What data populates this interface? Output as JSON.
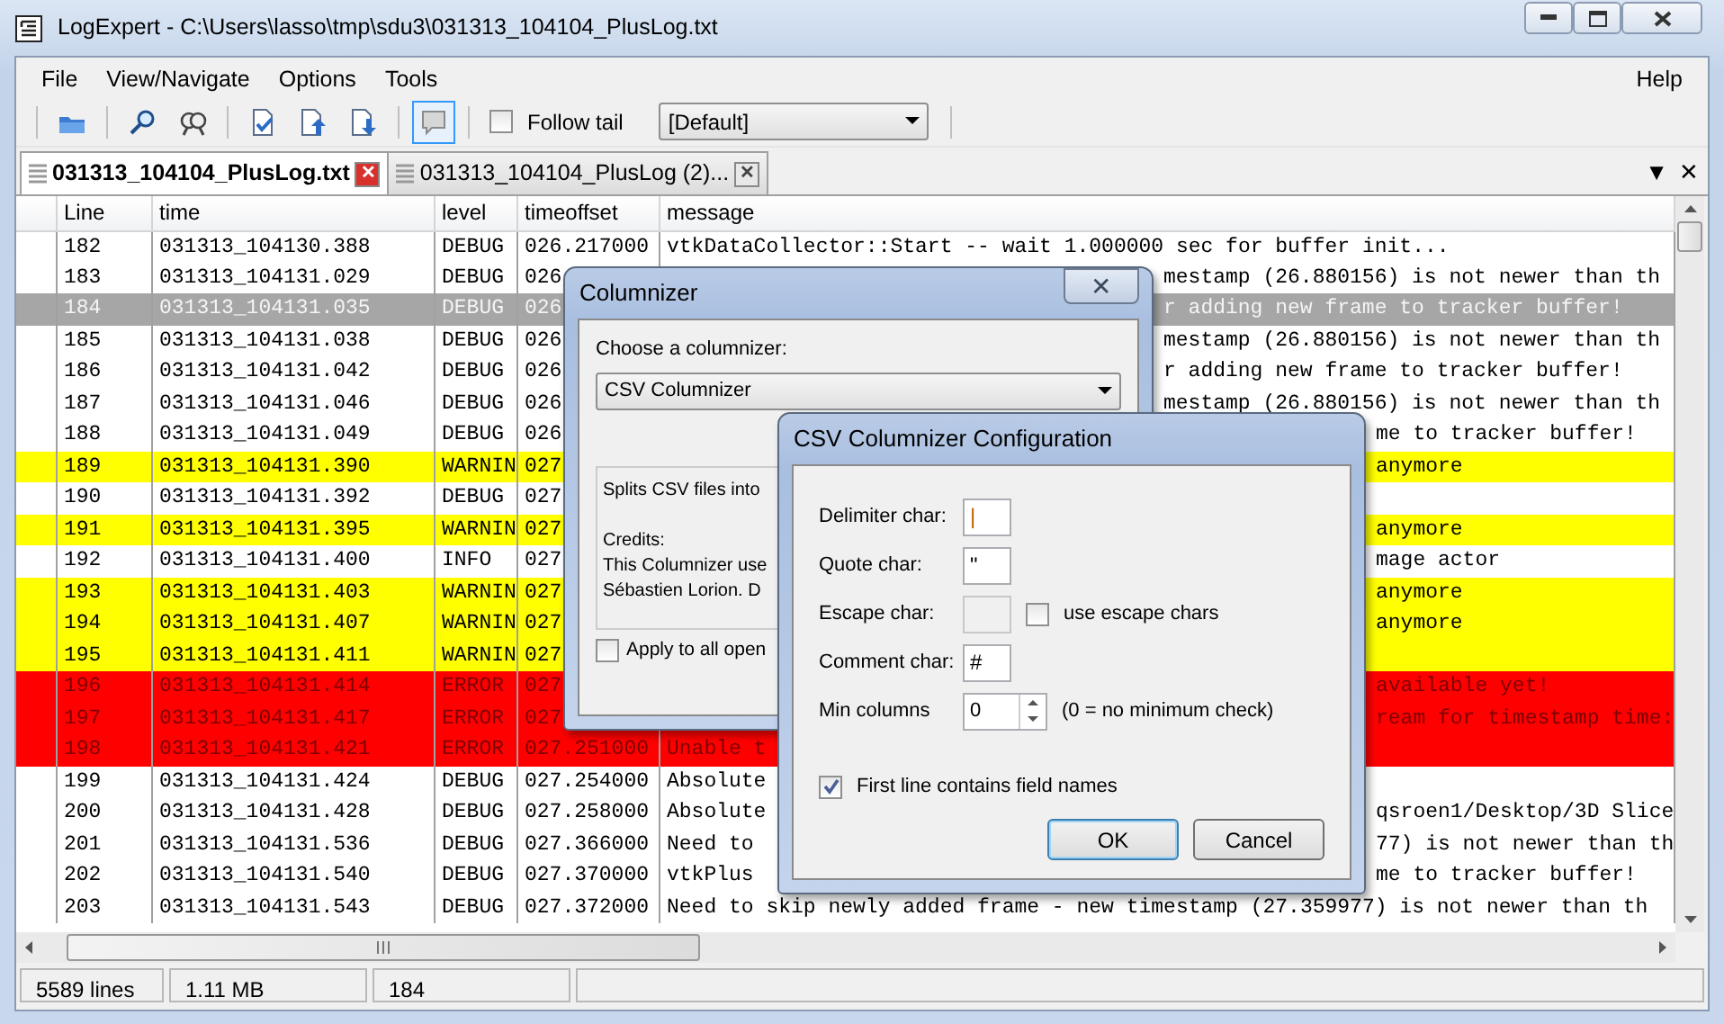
{
  "window": {
    "title": "LogExpert - C:\\Users\\lasso\\tmp\\sdu3\\031313_104104_PlusLog.txt"
  },
  "menu": {
    "items": [
      {
        "label": "File"
      },
      {
        "label": "View/Navigate"
      },
      {
        "label": "Options"
      },
      {
        "label": "Tools"
      }
    ],
    "right_items": [
      {
        "label": "Help"
      }
    ]
  },
  "toolbar": {
    "buttons": [
      {
        "selected": false
      },
      {
        "selected": false
      },
      {
        "selected": false
      },
      {
        "selected": false
      },
      {
        "selected": false
      },
      {
        "selected": false
      },
      {
        "selected": true
      }
    ],
    "follow_tail": {
      "label": "Follow tail",
      "checked": false
    },
    "filter_select": {
      "value": "[Default]"
    }
  },
  "tabs": [
    {
      "label": "031313_104104_PlusLog.txt",
      "selected": true,
      "close": "✕"
    },
    {
      "label": "031313_104104_PlusLog  (2)...",
      "selected": false,
      "close": "✕"
    }
  ],
  "tab_strip_controls": [
    "▼",
    "✕"
  ],
  "table": {
    "columns": [
      "Line",
      "time",
      "level",
      "timeoffset",
      "message"
    ],
    "rows": [
      {
        "line": "182",
        "time": "031313_104130.388",
        "level": "DEBUG",
        "timeoffset": "026.217000",
        "message": "vtkDataCollector::Start -- wait 1.000000 sec for buffer init...",
        "color": "#ffffff",
        "selected": false
      },
      {
        "line": "183",
        "time": "031313_104131.029",
        "level": "DEBUG",
        "timeoffset": "026",
        "message_right": "mestamp (26.880156) is not newer than th",
        "color": "#ffffff",
        "selected": false
      },
      {
        "line": "184",
        "time": "031313_104131.035",
        "level": "DEBUG",
        "timeoffset": "026",
        "message_right": "r adding new frame to tracker buffer!",
        "selected": true
      },
      {
        "line": "185",
        "time": "031313_104131.038",
        "level": "DEBUG",
        "timeoffset": "026",
        "message_right": "mestamp (26.880156) is not newer than th",
        "color": "#ffffff",
        "selected": false
      },
      {
        "line": "186",
        "time": "031313_104131.042",
        "level": "DEBUG",
        "timeoffset": "026",
        "message_right": "r adding new frame to tracker buffer!",
        "color": "#ffffff",
        "selected": false
      },
      {
        "line": "187",
        "time": "031313_104131.046",
        "level": "DEBUG",
        "timeoffset": "026",
        "message_right": "mestamp (26.880156) is not newer than th",
        "color": "#ffffff",
        "selected": false
      },
      {
        "line": "188",
        "time": "031313_104131.049",
        "level": "DEBUG",
        "timeoffset": "026",
        "message_right": "me to tracker buffer!",
        "color": "#ffffff",
        "selected": false
      },
      {
        "line": "189",
        "time": "031313_104131.390",
        "level": "WARNIN",
        "timeoffset": "027",
        "message_right": "anymore",
        "color": "#ffff00",
        "selected": false
      },
      {
        "line": "190",
        "time": "031313_104131.392",
        "level": "DEBUG",
        "timeoffset": "027",
        "color": "#ffffff",
        "selected": false
      },
      {
        "line": "191",
        "time": "031313_104131.395",
        "level": "WARNIN",
        "timeoffset": "027",
        "message_right": "anymore",
        "color": "#ffff00",
        "selected": false
      },
      {
        "line": "192",
        "time": "031313_104131.400",
        "level": "INFO",
        "timeoffset": "027",
        "message_right": "mage actor",
        "color": "#ffffff",
        "selected": false
      },
      {
        "line": "193",
        "time": "031313_104131.403",
        "level": "WARNIN",
        "timeoffset": "027",
        "message_right": "anymore",
        "color": "#ffff00",
        "selected": false
      },
      {
        "line": "194",
        "time": "031313_104131.407",
        "level": "WARNIN",
        "timeoffset": "027",
        "message_right": "anymore",
        "color": "#ffff00",
        "selected": false
      },
      {
        "line": "195",
        "time": "031313_104131.411",
        "level": "WARNIN",
        "timeoffset": "027",
        "color": "#ffff00",
        "selected": false
      },
      {
        "line": "196",
        "time": "031313_104131.414",
        "level": "ERROR",
        "timeoffset": "027",
        "message_right": "available yet!",
        "color": "#ff0000",
        "selected": false
      },
      {
        "line": "197",
        "time": "031313_104131.417",
        "level": "ERROR",
        "timeoffset": "027",
        "message_right": "ream for timestamp time:",
        "color": "#ff0000",
        "selected": false
      },
      {
        "line": "198",
        "time": "031313_104131.421",
        "level": "ERROR",
        "timeoffset": "027.251000",
        "message": "Unable t",
        "color": "#ff0000",
        "selected": false
      },
      {
        "line": "199",
        "time": "031313_104131.424",
        "level": "DEBUG",
        "timeoffset": "027.254000",
        "message": "Absolute",
        "color": "#ffffff",
        "selected": false
      },
      {
        "line": "200",
        "time": "031313_104131.428",
        "level": "DEBUG",
        "timeoffset": "027.258000",
        "message": "Absolute",
        "message_right": "qsroen1/Desktop/3D Slice",
        "color": "#ffffff",
        "selected": false
      },
      {
        "line": "201",
        "time": "031313_104131.536",
        "level": "DEBUG",
        "timeoffset": "027.366000",
        "message": "Need to",
        "message_right": "77) is not newer than th",
        "color": "#ffffff",
        "selected": false
      },
      {
        "line": "202",
        "time": "031313_104131.540",
        "level": "DEBUG",
        "timeoffset": "027.370000",
        "message": "vtkPlus",
        "message_right": "me to tracker buffer!",
        "color": "#ffffff",
        "selected": false
      },
      {
        "line": "203",
        "time": "031313_104131.543",
        "level": "DEBUG",
        "timeoffset": "027.372000",
        "message": "Need to skip newly added frame - new timestamp (27.359977) is not newer than th",
        "color": "#ffffff",
        "selected": false
      }
    ]
  },
  "status_bar": [
    "5589 lines",
    "1.11 MB",
    "184"
  ],
  "columnizer_dialog": {
    "title": "Columnizer",
    "close": "✕",
    "prompt": "Choose a columnizer:",
    "selected_value": "CSV Columnizer",
    "description": {
      "summary": "Splits CSV files into",
      "credits": [
        "Credits:",
        "This Columnizer use",
        "Sébastien Lorion. D"
      ]
    },
    "apply_all": {
      "label": "Apply to all open",
      "checked": false
    }
  },
  "csv_dialog": {
    "title": "CSV Columnizer Configuration",
    "fields": [
      {
        "kind": "text",
        "label": "Delimiter char:",
        "value": "|",
        "disabled": false
      },
      {
        "kind": "text",
        "label": "Quote char:",
        "value": "\"",
        "disabled": false
      },
      {
        "kind": "text",
        "label": "Escape char:",
        "disabled": true,
        "checkbox": {
          "label": "use escape chars",
          "checked": false
        }
      },
      {
        "kind": "text",
        "label": "Comment char:",
        "value": "#",
        "disabled": false
      },
      {
        "kind": "spinner",
        "label": "Min columns",
        "value": "0",
        "disabled": false,
        "note": "(0 = no minimum check)"
      }
    ],
    "first_line": {
      "label": "First line contains field names",
      "checked": true
    },
    "buttons": [
      {
        "label": "OK",
        "default": true
      },
      {
        "label": "Cancel",
        "default": false
      }
    ]
  }
}
